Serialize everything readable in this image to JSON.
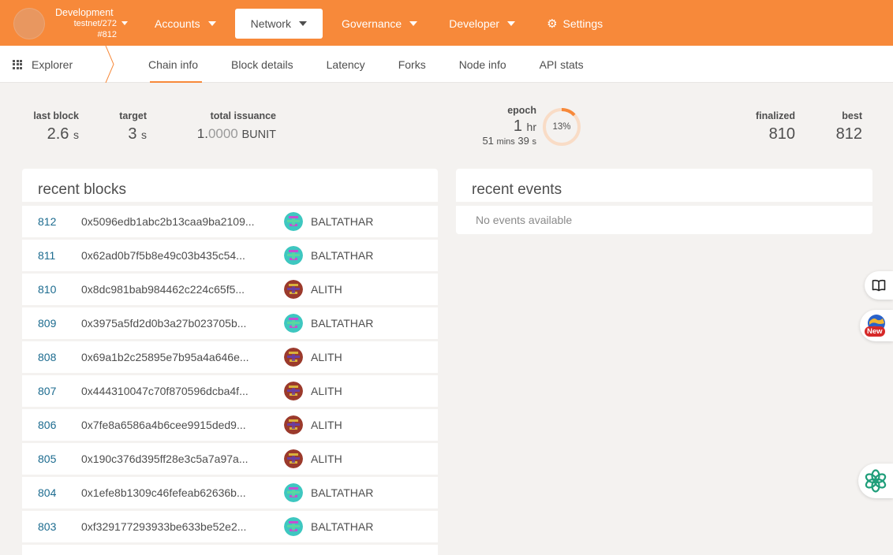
{
  "chain": {
    "name": "Development",
    "runtime": "testnet/272",
    "block": "#812"
  },
  "menu": {
    "accounts": "Accounts",
    "network": "Network",
    "governance": "Governance",
    "developer": "Developer",
    "settings": "Settings"
  },
  "subnav": {
    "section": "Explorer",
    "tabs": [
      "Chain info",
      "Block details",
      "Latency",
      "Forks",
      "Node info",
      "API stats"
    ]
  },
  "stats": {
    "last_block_label": "last block",
    "last_block_value": "2.6",
    "last_block_unit": "s",
    "target_label": "target",
    "target_value": "3",
    "target_unit": "s",
    "issuance_label": "total issuance",
    "issuance_int": "1.",
    "issuance_dec": "0000",
    "issuance_unit": "BUNIT",
    "epoch_label": "epoch",
    "epoch_hr": "1",
    "epoch_hr_unit": "hr",
    "epoch_mins": "51",
    "epoch_mins_unit": "mins",
    "epoch_secs": "39",
    "epoch_secs_unit": "s",
    "epoch_progress": 0.13,
    "epoch_pct_text": "13%",
    "finalized_label": "finalized",
    "finalized_value": "810",
    "best_label": "best",
    "best_value": "812"
  },
  "recent_blocks": {
    "title": "recent blocks",
    "rows": [
      {
        "number": "812",
        "hash": "0x5096edb1abc2b13caa9ba2109...",
        "author": "BALTATHAR"
      },
      {
        "number": "811",
        "hash": "0x62ad0b7f5b8e49c03b435c54...",
        "author": "BALTATHAR"
      },
      {
        "number": "810",
        "hash": "0x8dc981bab984462c224c65f5...",
        "author": "ALITH"
      },
      {
        "number": "809",
        "hash": "0x3975a5fd2d0b3a27b023705b...",
        "author": "BALTATHAR"
      },
      {
        "number": "808",
        "hash": "0x69a1b2c25895e7b95a4a646e...",
        "author": "ALITH"
      },
      {
        "number": "807",
        "hash": "0x444310047c70f870596dcba4f...",
        "author": "ALITH"
      },
      {
        "number": "806",
        "hash": "0x7fe8a6586a4b6cee9915ded9...",
        "author": "ALITH"
      },
      {
        "number": "805",
        "hash": "0x190c376d395ff28e3c5a7a97a...",
        "author": "ALITH"
      },
      {
        "number": "804",
        "hash": "0x1efe8b1309c46fefeab62636b...",
        "author": "BALTATHAR"
      },
      {
        "number": "803",
        "hash": "0xf329177293933be633be52e2...",
        "author": "BALTATHAR"
      }
    ]
  },
  "recent_events": {
    "title": "recent events",
    "empty": "No events available"
  },
  "side": {
    "new_badge": "New"
  },
  "colors": {
    "accent": "#f7893a",
    "link": "#1c6b8f",
    "baltathar_avatar": "#3ec7c0",
    "alith_avatar": "#9b3a2c"
  }
}
